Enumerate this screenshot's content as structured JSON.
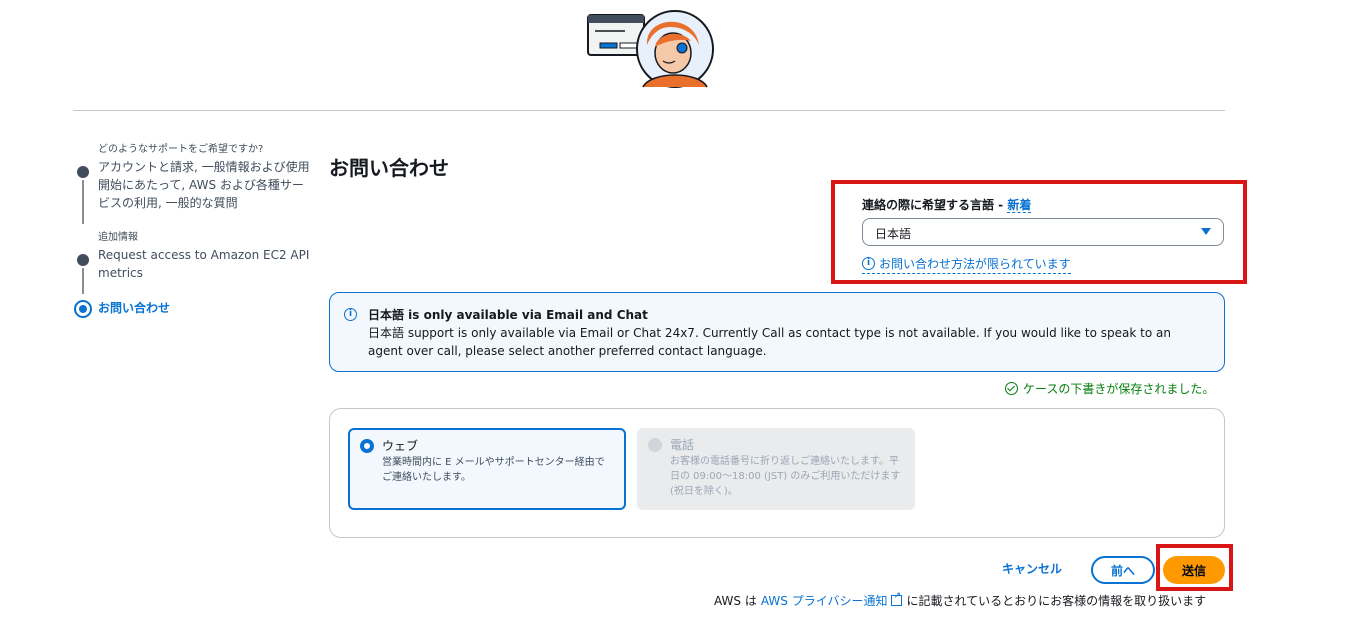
{
  "colors": {
    "accent": "#0972d3",
    "highlight": "#d91515",
    "primary_button": "#ff9900",
    "success": "#037f0c"
  },
  "steps": [
    {
      "label": "どのようなサポートをご希望ですか?",
      "text": "アカウントと請求, 一般情報および使用開始にあたって, AWS および各種サービスの利用, 一般的な質問"
    },
    {
      "label": "追加情報",
      "text": "Request access to Amazon EC2 API metrics"
    },
    {
      "label": "お問い合わせ",
      "active": true
    }
  ],
  "page": {
    "title": "お問い合わせ"
  },
  "language": {
    "label": "連絡の際に希望する言語 - ",
    "new_badge": "新着",
    "selected": "日本語",
    "info_link": "お問い合わせ方法が限られています"
  },
  "alert": {
    "title": "日本語 is only available via Email and Chat",
    "body": "日本語 support is only available via Email or Chat 24x7. Currently Call as contact type is not available. If you would like to speak to an agent over call, please select another preferred contact language."
  },
  "saved_status": "ケースの下書きが保存されました。",
  "contact_options": [
    {
      "title": "ウェブ",
      "desc": "営業時間内に E メールやサポートセンター経由でご連絡いたします。",
      "selected": true,
      "disabled": false
    },
    {
      "title": "電話",
      "desc": "お客様の電話番号に折り返しご連絡いたします。平日の 09:00～18:00 (JST) のみご利用いただけます (祝日を除く)。",
      "selected": false,
      "disabled": true
    }
  ],
  "buttons": {
    "cancel": "キャンセル",
    "prev": "前へ",
    "submit": "送信"
  },
  "footer": {
    "prefix": "AWS は",
    "link": "AWS プライバシー通知",
    "suffix": "に記載されているとおりにお客様の情報を取り扱います"
  }
}
